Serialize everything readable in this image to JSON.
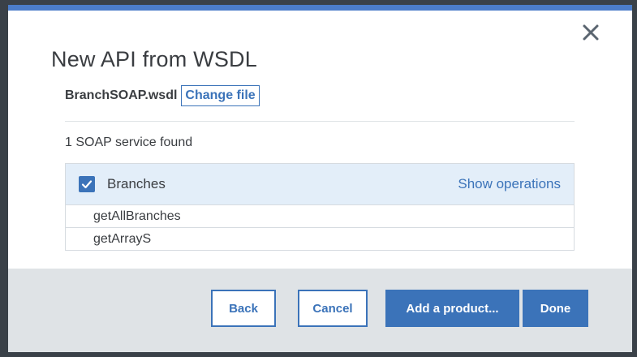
{
  "dialog": {
    "title": "New API from WSDL",
    "file_name": "BranchSOAP.wsdl",
    "change_file_label": "Change file",
    "found_text": "1 SOAP service found",
    "close_icon": "close-icon",
    "accent_color": "#3b73b9"
  },
  "service": {
    "name": "Branches",
    "checked": true,
    "show_operations_label": "Show operations",
    "operations": [
      "getAllBranches",
      "getArrayS"
    ]
  },
  "footer": {
    "back_label": "Back",
    "cancel_label": "Cancel",
    "add_product_label": "Add a product...",
    "done_label": "Done"
  }
}
